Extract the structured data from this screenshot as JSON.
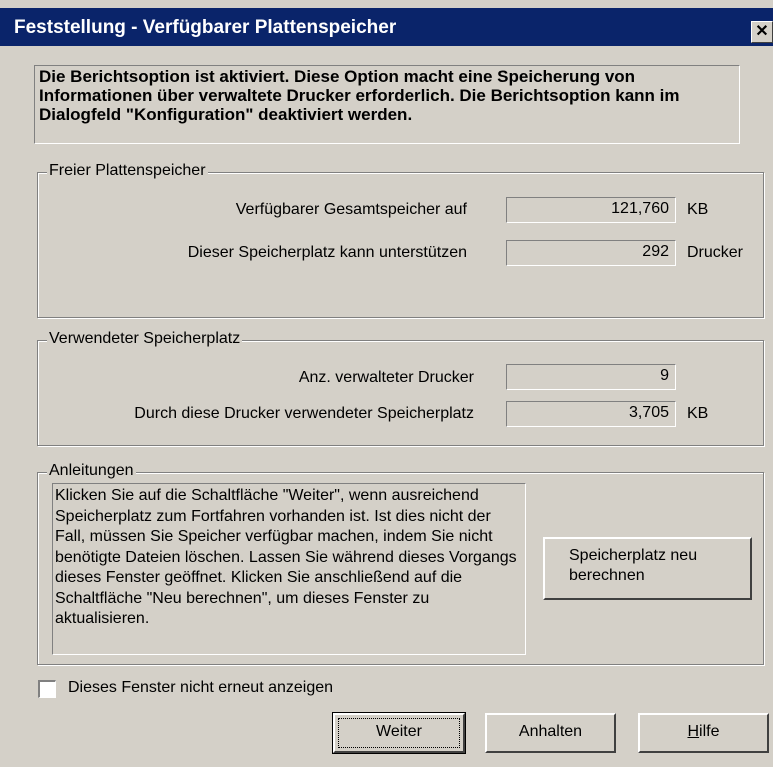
{
  "window": {
    "title": "Feststellung - Verfügbarer Plattenspeicher",
    "close_glyph": "✕"
  },
  "notice": "Die Berichtsoption ist aktiviert. Diese Option macht eine Speicherung von Informationen über verwaltete Drucker erforderlich. Die Berichtsoption kann im Dialogfeld \"Konfiguration\" deaktiviert werden.",
  "free_space": {
    "legend": "Freier Plattenspeicher",
    "total_label": "Verfügbarer Gesamtspeicher auf",
    "total_value": "121,760",
    "total_unit": "KB",
    "support_label": "Dieser Speicherplatz kann unterstützen",
    "support_value": "292",
    "support_unit": "Drucker"
  },
  "used_space": {
    "legend": "Verwendeter Speicherplatz",
    "count_label": "Anz. verwalteter Drucker",
    "count_value": "9",
    "used_label": "Durch diese Drucker verwendeter Speicherplatz",
    "used_value": "3,705",
    "used_unit": "KB"
  },
  "instructions": {
    "legend": "Anleitungen",
    "text": "Klicken Sie auf die Schaltfläche \"Weiter\", wenn ausreichend Speicherplatz zum Fortfahren vorhanden ist. Ist dies nicht der Fall, müssen Sie Speicher verfügbar machen, indem Sie nicht benötigte Dateien löschen. Lassen Sie während dieses Vorgangs dieses Fenster geöffnet. Klicken Sie anschließend auf die Schaltfläche \"Neu berechnen\", um dieses Fenster zu aktualisieren.",
    "recalc_line1": "Speicherplatz neu",
    "recalc_line2": "berechnen"
  },
  "checkbox": {
    "label": "Dieses Fenster nicht erneut anzeigen",
    "checked": false
  },
  "buttons": {
    "continue": "Weiter",
    "stop": "Anhalten",
    "help_mnemonic": "H",
    "help_rest": "ilfe"
  }
}
